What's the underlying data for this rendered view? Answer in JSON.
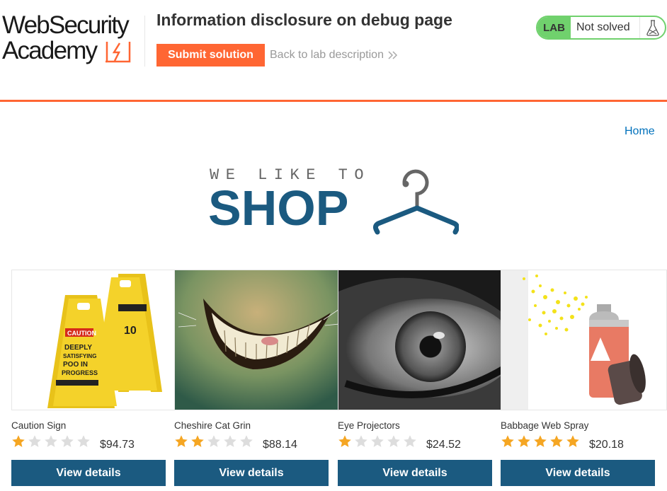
{
  "header": {
    "logo_line1": "WebSecurity",
    "logo_line2": "Academy",
    "lab_title": "Information disclosure on debug page",
    "submit_label": "Submit solution",
    "back_label": "Back to lab description",
    "lab_badge": "LAB",
    "lab_status": "Not solved",
    "colors": {
      "accent": "#ff6633",
      "status_green": "#70d16d"
    }
  },
  "nav": {
    "home_label": "Home"
  },
  "banner": {
    "tagline": "WE LIKE TO",
    "word": "SHOP",
    "icon": "hanger-icon"
  },
  "products": [
    {
      "name": "Caution Sign",
      "rating": 1,
      "price": "$94.73",
      "button": "View details",
      "image": "caution-sign-image"
    },
    {
      "name": "Cheshire Cat Grin",
      "rating": 2,
      "price": "$88.14",
      "button": "View details",
      "image": "cheshire-grin-image"
    },
    {
      "name": "Eye Projectors",
      "rating": 1,
      "price": "$24.52",
      "button": "View details",
      "image": "eye-image"
    },
    {
      "name": "Babbage Web Spray",
      "rating": 5,
      "price": "$20.18",
      "button": "View details",
      "image": "spray-can-image"
    }
  ],
  "colors": {
    "brand_blue": "#1b5a80",
    "link_blue": "#0071bc",
    "star_gold": "#f5a623",
    "star_grey": "#dddddd"
  }
}
